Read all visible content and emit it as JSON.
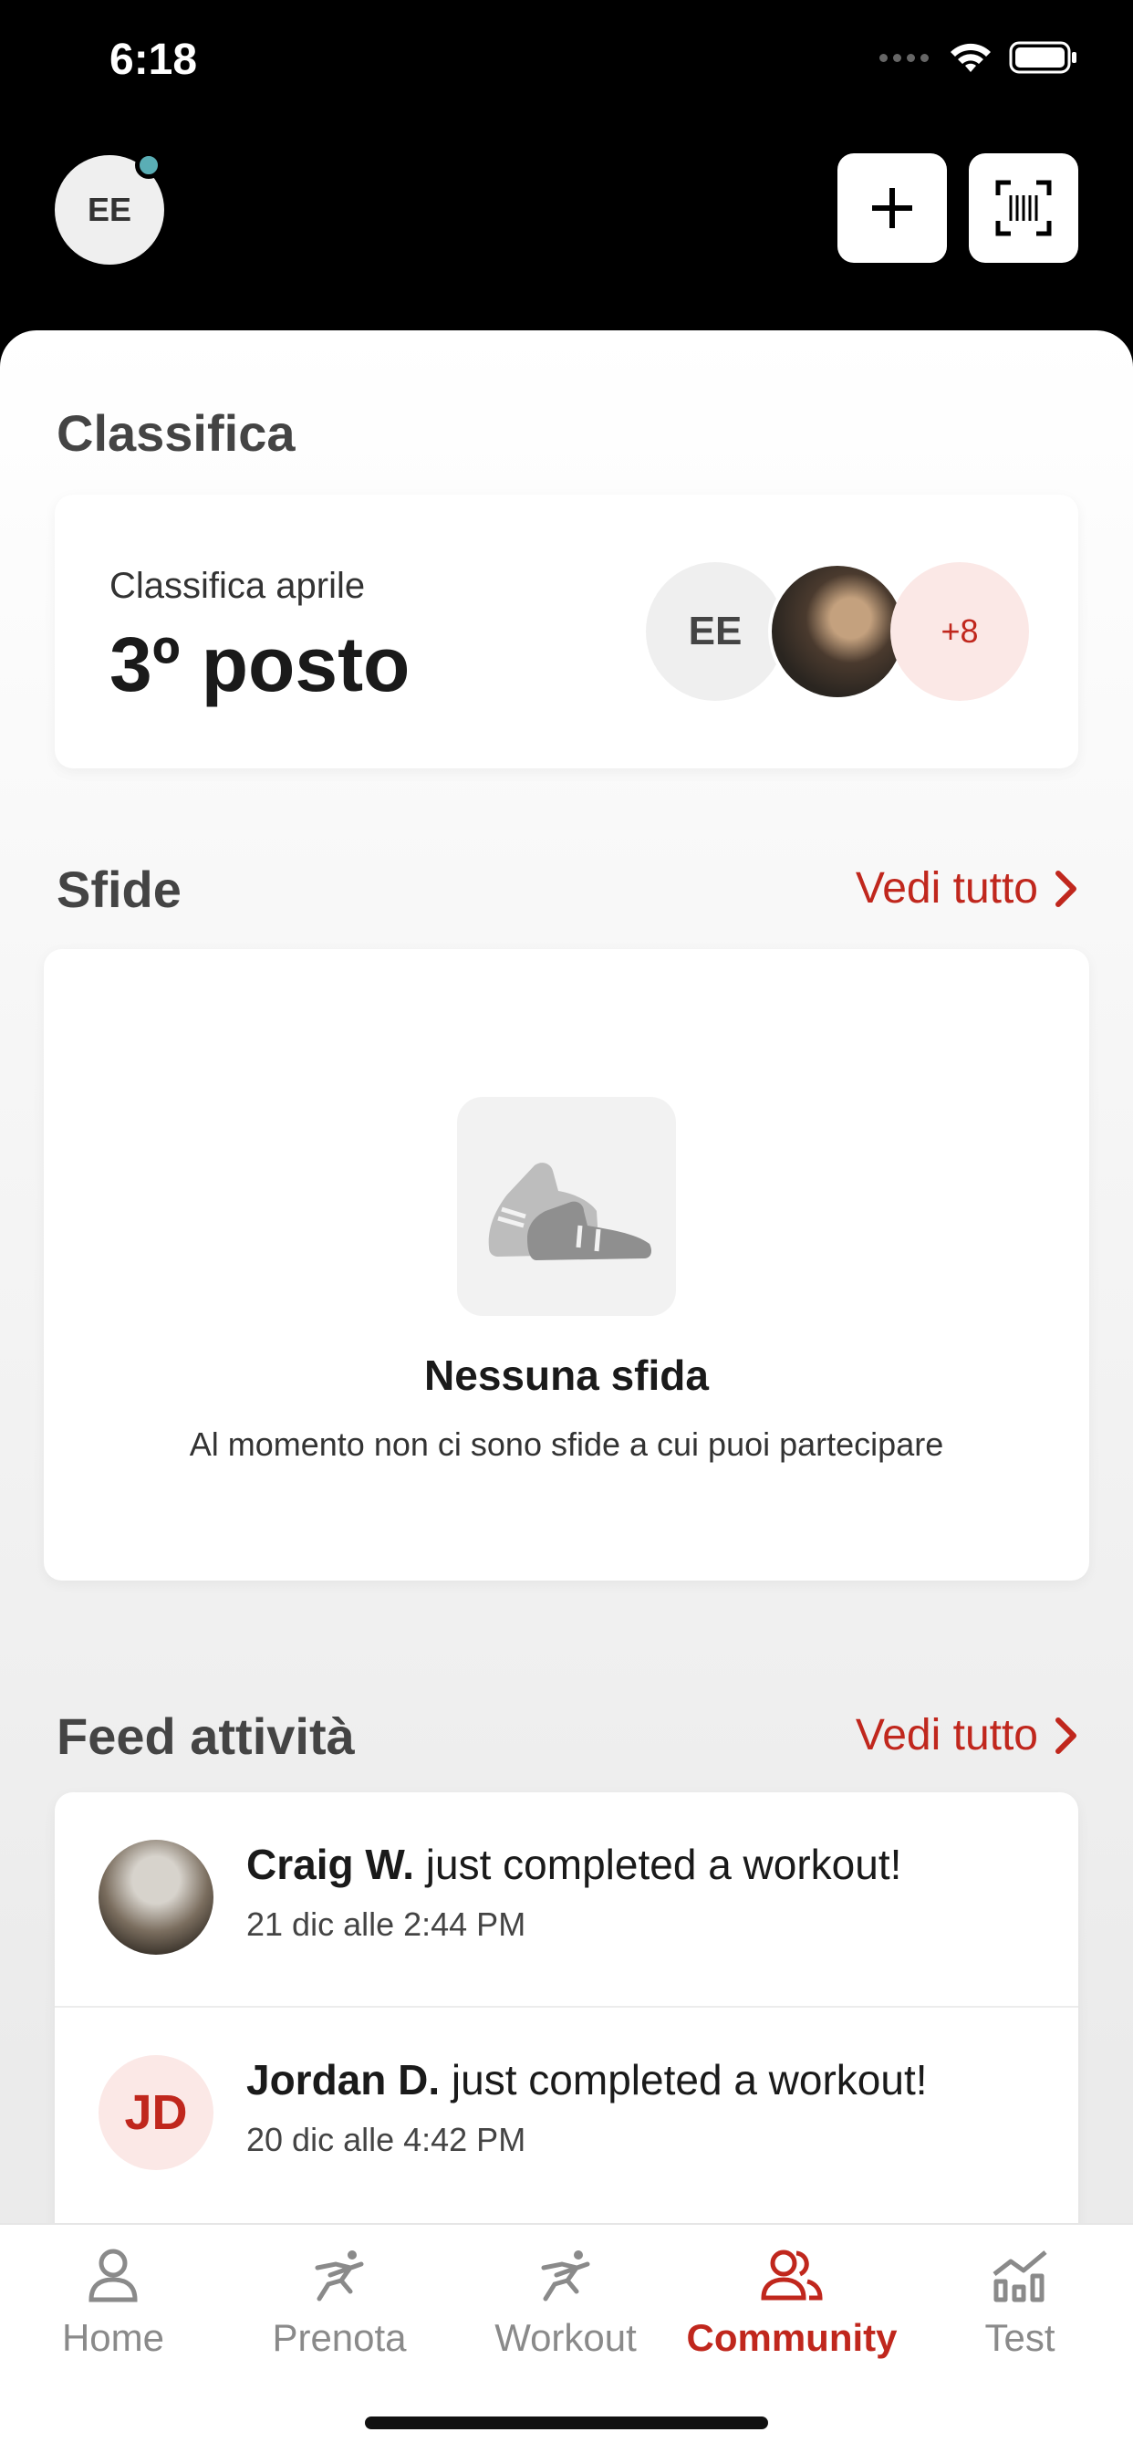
{
  "status_bar": {
    "time": "6:18"
  },
  "header": {
    "avatar_initials": "EE"
  },
  "leaderboard": {
    "section_title": "Classifica",
    "label": "Classifica aprile",
    "position": "3º posto",
    "avatars": [
      {
        "type": "initials",
        "text": "EE"
      },
      {
        "type": "photo"
      },
      {
        "type": "more",
        "text": "+8"
      }
    ]
  },
  "challenges": {
    "section_title": "Sfide",
    "see_all": "Vedi tutto",
    "empty_title": "Nessuna sfida",
    "empty_text": "Al momento non ci sono sfide a cui puoi partecipare"
  },
  "feed": {
    "section_title": "Feed attività",
    "see_all": "Vedi tutto",
    "items": [
      {
        "name": "Craig W.",
        "action": " just completed a workout!",
        "time": "21 dic alle 2:44 PM",
        "avatar": "photo"
      },
      {
        "name": "Jordan D.",
        "action": " just completed a workout!",
        "time": "20 dic alle 4:42 PM",
        "avatar": "JD"
      }
    ]
  },
  "tabs": [
    {
      "label": "Home",
      "icon": "person-icon",
      "active": false
    },
    {
      "label": "Prenota",
      "icon": "runner-icon",
      "active": false
    },
    {
      "label": "Workout",
      "icon": "runner-icon",
      "active": false
    },
    {
      "label": "Community",
      "icon": "people-icon",
      "active": true
    },
    {
      "label": "Test",
      "icon": "chart-icon",
      "active": false
    }
  ],
  "colors": {
    "accent": "#c0271d",
    "notification": "#5aaeb5",
    "background": "#000000"
  }
}
